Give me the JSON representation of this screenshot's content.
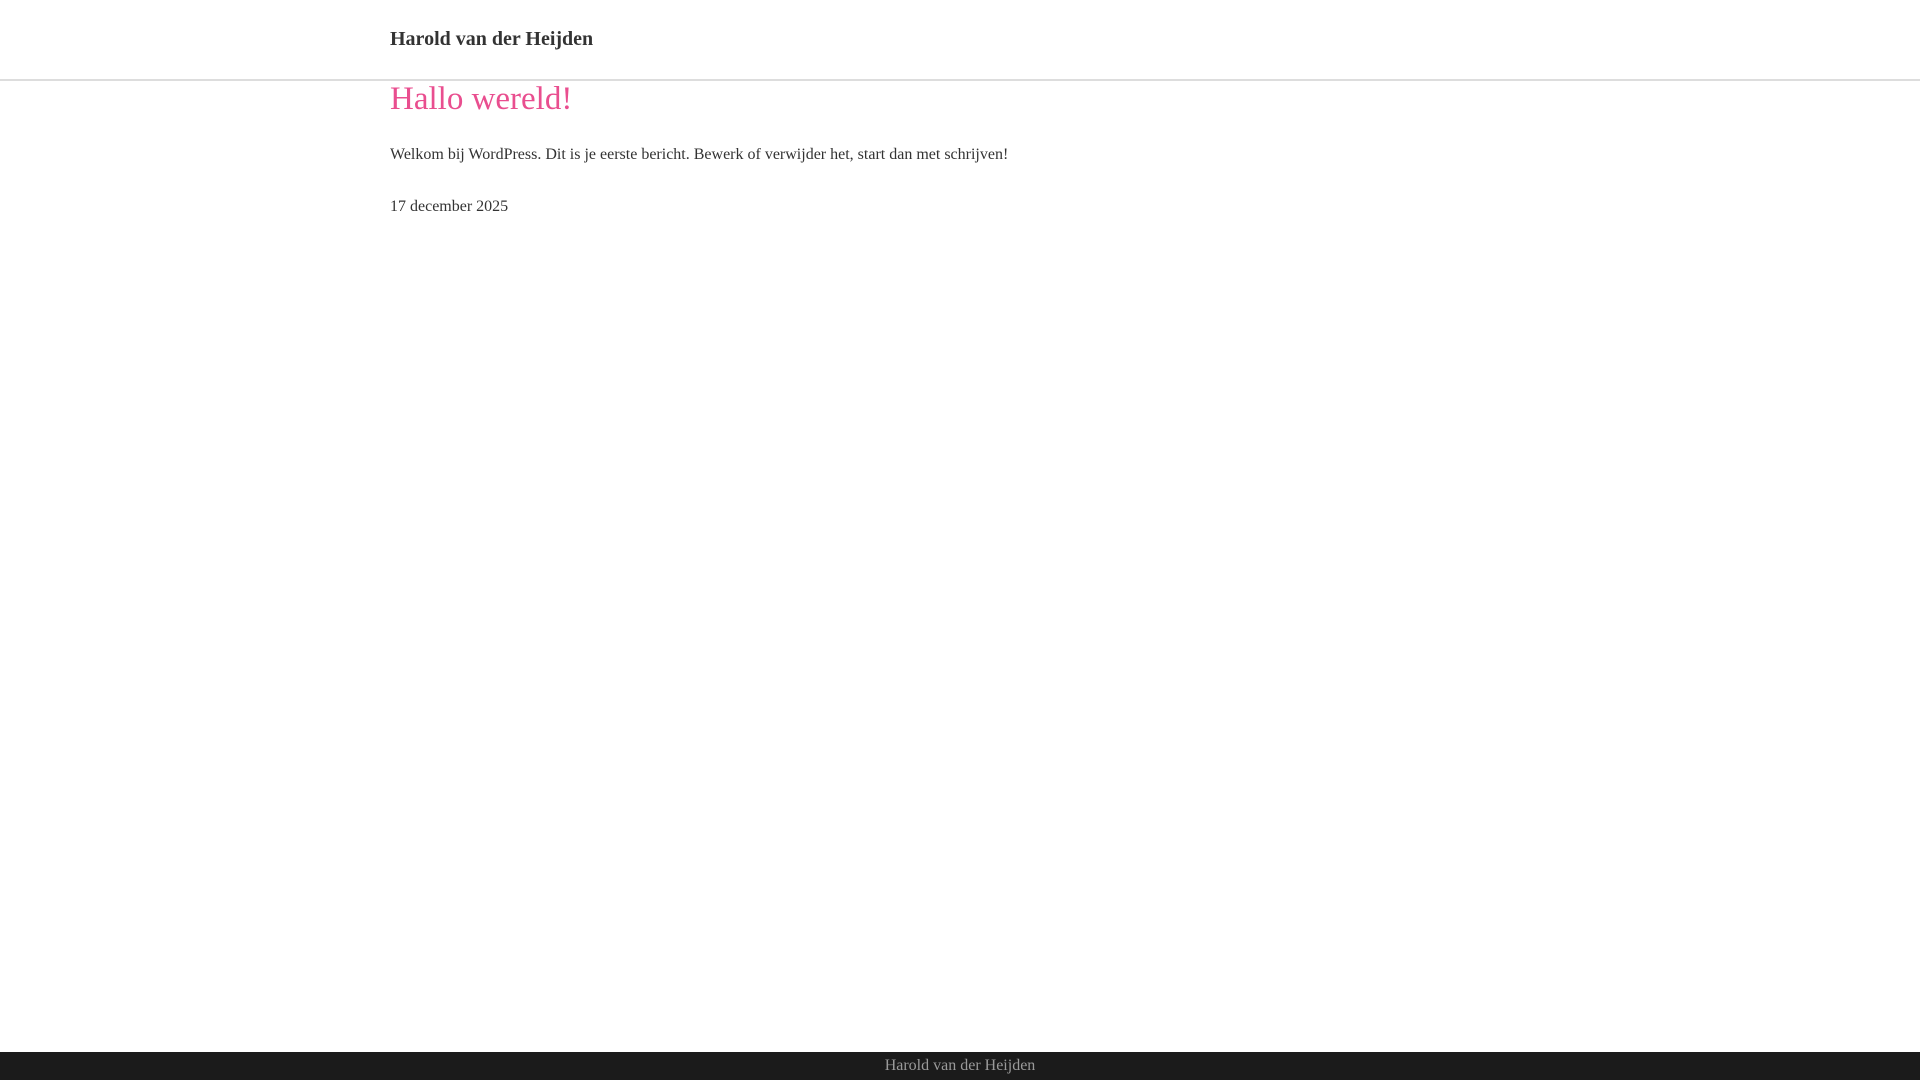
{
  "header": {
    "site_title": "Harold van der Heijden"
  },
  "post": {
    "title": "Hallo wereld!",
    "body": "Welkom bij WordPress. Dit is je eerste bericht. Bewerk of verwijder het, start dan met schrijven!",
    "date": "17 december 2025"
  },
  "footer": {
    "text": "Harold van der Heijden"
  },
  "colors": {
    "accent": "#e94e8f",
    "footer_bg": "#1b1b1b",
    "text": "#333333"
  }
}
